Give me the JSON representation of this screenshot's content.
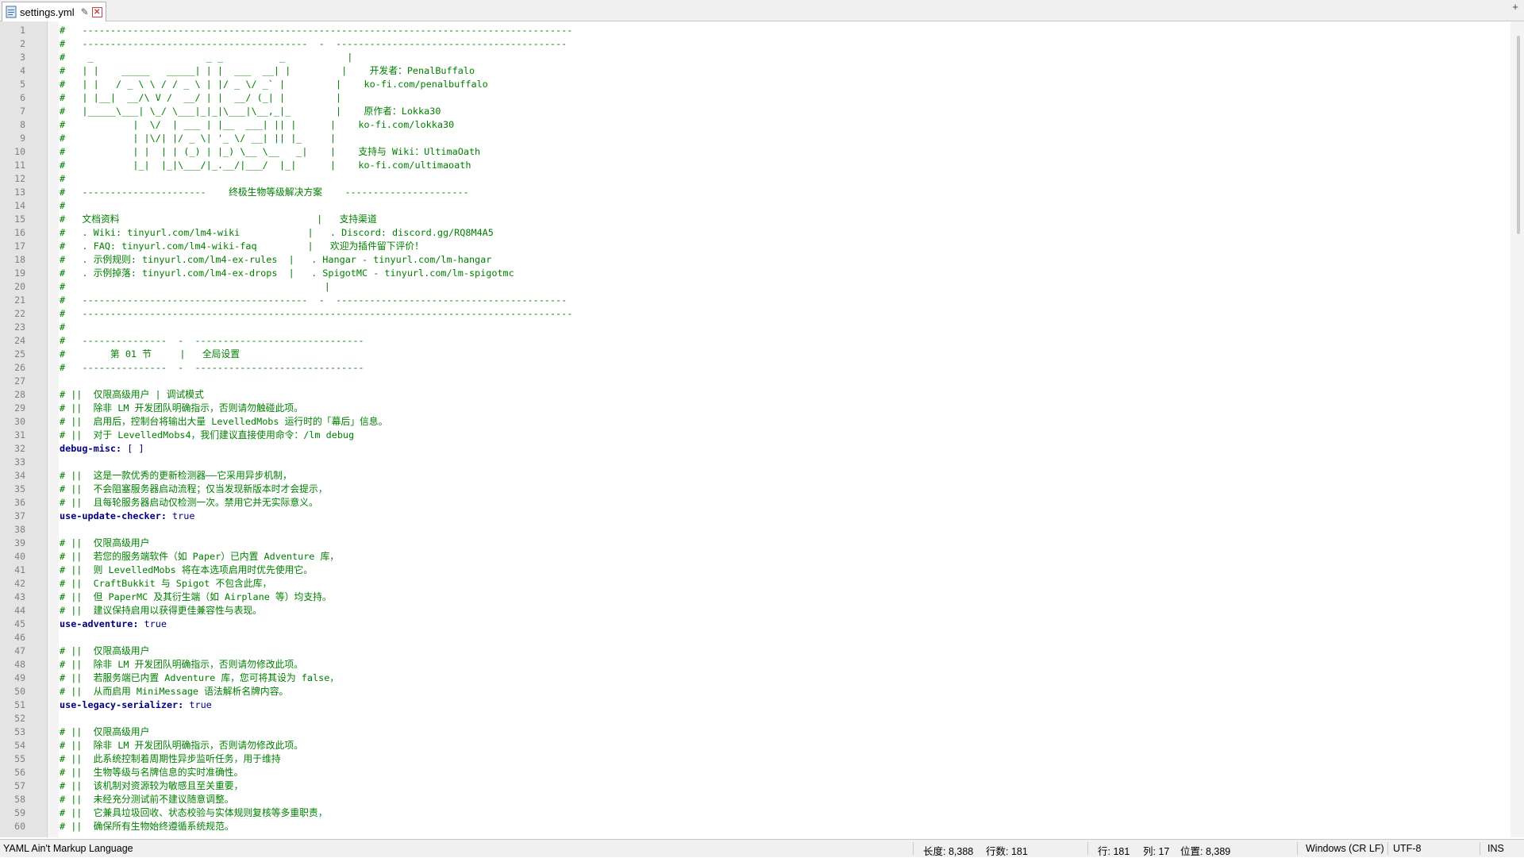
{
  "tab": {
    "filename": "settings.yml",
    "icons": [
      "file-icon",
      "pin-icon",
      "close-icon"
    ]
  },
  "lines": [
    {
      "n": "1",
      "parts": [
        [
          "c",
          "#   ---------------------------------------------------------------------------------------"
        ]
      ]
    },
    {
      "n": "2",
      "parts": [
        [
          "c",
          "#   ----------------------------------------  -  -----------------------------------------"
        ]
      ]
    },
    {
      "n": "3",
      "parts": [
        [
          "c",
          "#    _                    _ _          _           |"
        ]
      ]
    },
    {
      "n": "4",
      "parts": [
        [
          "c",
          "#   | |    _____   _____| | |  ___  __| |         |    开发者：PenalBuffalo"
        ]
      ]
    },
    {
      "n": "5",
      "parts": [
        [
          "c",
          "#   | |   / _ \\ \\ / / _ \\ | |/ _ \\/ _` |         |    ko-fi.com/penalbuffalo"
        ]
      ]
    },
    {
      "n": "6",
      "parts": [
        [
          "c",
          "#   | |__|  __/\\ V /  __/ | |  __/ (_| |         |"
        ]
      ]
    },
    {
      "n": "7",
      "parts": [
        [
          "c",
          "#   |_____\\___| \\_/ \\___|_|_|\\___|\\__,_|_        |    原作者：Lokka30"
        ]
      ]
    },
    {
      "n": "8",
      "parts": [
        [
          "c",
          "#            |  \\/  | ___ | |__  ___| || |      |    ko-fi.com/lokka30"
        ]
      ]
    },
    {
      "n": "9",
      "parts": [
        [
          "c",
          "#            | |\\/| |/ _ \\| '_ \\/ __| || |_     |"
        ]
      ]
    },
    {
      "n": "10",
      "parts": [
        [
          "c",
          "#            | |  | | (_) | |_) \\__ \\__   _|    |    支持与 Wiki：UltimaOath"
        ]
      ]
    },
    {
      "n": "11",
      "parts": [
        [
          "c",
          "#            |_|  |_|\\___/|_.__/|___/  |_|      |    ko-fi.com/ultimaoath"
        ]
      ]
    },
    {
      "n": "12",
      "parts": [
        [
          "c",
          "#"
        ]
      ]
    },
    {
      "n": "13",
      "parts": [
        [
          "c",
          "#   ----------------------    终极生物等级解决方案    ----------------------"
        ]
      ]
    },
    {
      "n": "14",
      "parts": [
        [
          "c",
          "#"
        ]
      ]
    },
    {
      "n": "15",
      "parts": [
        [
          "c",
          "#   文档资料                                   |   支持渠道"
        ]
      ]
    },
    {
      "n": "16",
      "parts": [
        [
          "c",
          "#   . Wiki: tinyurl.com/lm4-wiki            |   . Discord: discord.gg/RQ8M4A5"
        ]
      ]
    },
    {
      "n": "17",
      "parts": [
        [
          "c",
          "#   . FAQ: tinyurl.com/lm4-wiki-faq         |   欢迎为插件留下评价！"
        ]
      ]
    },
    {
      "n": "18",
      "parts": [
        [
          "c",
          "#   . 示例规则: tinyurl.com/lm4-ex-rules  |   . Hangar - tinyurl.com/lm-hangar"
        ]
      ]
    },
    {
      "n": "19",
      "parts": [
        [
          "c",
          "#   . 示例掉落: tinyurl.com/lm4-ex-drops  |   . SpigotMC - tinyurl.com/lm-spigotmc"
        ]
      ]
    },
    {
      "n": "20",
      "parts": [
        [
          "c",
          "#                                              |"
        ]
      ]
    },
    {
      "n": "21",
      "parts": [
        [
          "c",
          "#   ----------------------------------------  -  -----------------------------------------"
        ]
      ]
    },
    {
      "n": "22",
      "parts": [
        [
          "c",
          "#   ---------------------------------------------------------------------------------------"
        ]
      ]
    },
    {
      "n": "23",
      "parts": [
        [
          "c",
          "#"
        ]
      ]
    },
    {
      "n": "24",
      "parts": [
        [
          "c",
          "#   ---------------  -  ------------------------------"
        ]
      ]
    },
    {
      "n": "25",
      "parts": [
        [
          "c",
          "#        第 01 节     |   全局设置"
        ]
      ]
    },
    {
      "n": "26",
      "parts": [
        [
          "c",
          "#   ---------------  -  ------------------------------"
        ]
      ]
    },
    {
      "n": "27",
      "parts": []
    },
    {
      "n": "28",
      "parts": [
        [
          "c",
          "# ||  仅限高级用户 | 调试模式"
        ]
      ]
    },
    {
      "n": "29",
      "parts": [
        [
          "c",
          "# ||  除非 LM 开发团队明确指示，否则请勿触碰此项。"
        ]
      ]
    },
    {
      "n": "30",
      "parts": [
        [
          "c",
          "# ||  启用后，控制台将输出大量 LevelledMobs 运行时的「幕后」信息。"
        ]
      ]
    },
    {
      "n": "31",
      "parts": [
        [
          "c",
          "# ||  对于 LevelledMobs4，我们建议直接使用命令：/lm debug"
        ]
      ]
    },
    {
      "n": "32",
      "parts": [
        [
          "k",
          "debug-misc:"
        ],
        [
          "v",
          " [ ]"
        ]
      ]
    },
    {
      "n": "33",
      "parts": []
    },
    {
      "n": "34",
      "parts": [
        [
          "c",
          "# ||  这是一款优秀的更新检测器——它采用异步机制，"
        ]
      ]
    },
    {
      "n": "35",
      "parts": [
        [
          "c",
          "# ||  不会阻塞服务器启动流程；仅当发现新版本时才会提示，"
        ]
      ]
    },
    {
      "n": "36",
      "parts": [
        [
          "c",
          "# ||  且每轮服务器启动仅检测一次。禁用它并无实际意义。"
        ]
      ]
    },
    {
      "n": "37",
      "parts": [
        [
          "k",
          "use-update-checker:"
        ],
        [
          "v",
          " true"
        ]
      ]
    },
    {
      "n": "38",
      "parts": []
    },
    {
      "n": "39",
      "parts": [
        [
          "c",
          "# ||  仅限高级用户"
        ]
      ]
    },
    {
      "n": "40",
      "parts": [
        [
          "c",
          "# ||  若您的服务端软件（如 Paper）已内置 Adventure 库，"
        ]
      ]
    },
    {
      "n": "41",
      "parts": [
        [
          "c",
          "# ||  则 LevelledMobs 将在本选项启用时优先使用它。"
        ]
      ]
    },
    {
      "n": "42",
      "parts": [
        [
          "c",
          "# ||  CraftBukkit 与 Spigot 不包含此库，"
        ]
      ]
    },
    {
      "n": "43",
      "parts": [
        [
          "c",
          "# ||  但 PaperMC 及其衍生端（如 Airplane 等）均支持。"
        ]
      ]
    },
    {
      "n": "44",
      "parts": [
        [
          "c",
          "# ||  建议保持启用以获得更佳兼容性与表现。"
        ]
      ]
    },
    {
      "n": "45",
      "parts": [
        [
          "k",
          "use-adventure:"
        ],
        [
          "v",
          " true"
        ]
      ]
    },
    {
      "n": "46",
      "parts": []
    },
    {
      "n": "47",
      "parts": [
        [
          "c",
          "# ||  仅限高级用户"
        ]
      ]
    },
    {
      "n": "48",
      "parts": [
        [
          "c",
          "# ||  除非 LM 开发团队明确指示，否则请勿修改此项。"
        ]
      ]
    },
    {
      "n": "49",
      "parts": [
        [
          "c",
          "# ||  若服务端已内置 Adventure 库，您可将其设为 false，"
        ]
      ]
    },
    {
      "n": "50",
      "parts": [
        [
          "c",
          "# ||  从而启用 MiniMessage 语法解析名牌内容。"
        ]
      ]
    },
    {
      "n": "51",
      "parts": [
        [
          "k",
          "use-legacy-serializer:"
        ],
        [
          "v",
          " true"
        ]
      ]
    },
    {
      "n": "52",
      "parts": []
    },
    {
      "n": "53",
      "parts": [
        [
          "c",
          "# ||  仅限高级用户"
        ]
      ]
    },
    {
      "n": "54",
      "parts": [
        [
          "c",
          "# ||  除非 LM 开发团队明确指示，否则请勿修改此项。"
        ]
      ]
    },
    {
      "n": "55",
      "parts": [
        [
          "c",
          "# ||  此系统控制着周期性异步监听任务，用于维持"
        ]
      ]
    },
    {
      "n": "56",
      "parts": [
        [
          "c",
          "# ||  生物等级与名牌信息的实时准确性。"
        ]
      ]
    },
    {
      "n": "57",
      "parts": [
        [
          "c",
          "# ||  该机制对资源较为敏感且至关重要，"
        ]
      ]
    },
    {
      "n": "58",
      "parts": [
        [
          "c",
          "# ||  未经充分测试前不建议随意调整。"
        ]
      ]
    },
    {
      "n": "59",
      "parts": [
        [
          "c",
          "# ||  它兼具垃圾回收、状态校验与实体规则复核等多重职责，"
        ]
      ]
    },
    {
      "n": "60",
      "parts": [
        [
          "c",
          "# ||  确保所有生物始终遵循系统规范。"
        ]
      ]
    }
  ],
  "status": {
    "language": "YAML Ain't Markup Language",
    "length": "长度: 8,388",
    "lines": "行数: 181",
    "row": "行: 181",
    "col": "列: 17",
    "pos": "位置: 8,389",
    "eol": "Windows (CR LF)",
    "encoding": "UTF-8",
    "mode": "INS"
  },
  "colors": {
    "comment": "#008000",
    "key": "#000080",
    "gutter": "#e4e4e4"
  }
}
